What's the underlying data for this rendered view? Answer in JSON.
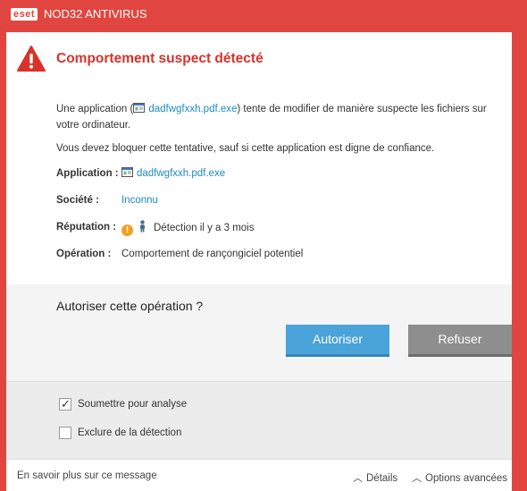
{
  "window": {
    "brand": "eset",
    "title": "NOD32 ANTIVIRUS",
    "accent": "#e0463f"
  },
  "alert": {
    "heading": "Comportement suspect détecté",
    "message_pre": "Une application (",
    "app_name": "dadfwgfxxh.pdf.exe",
    "message_post": ") tente de modifier de manière suspecte les fichiers sur votre ordinateur.",
    "advice": "Vous devez bloquer cette tentative, sauf si cette application est digne de confiance."
  },
  "details": {
    "application_label": "Application :",
    "application_value": "dadfwgfxxh.pdf.exe",
    "company_label": "Société :",
    "company_value": "Inconnu",
    "reputation_label": "Réputation :",
    "reputation_value": "Détection il y a 3 mois",
    "operation_label": "Opération :",
    "operation_value": "Comportement de rançongiciel potentiel"
  },
  "prompt": {
    "question": "Autoriser cette opération ?",
    "allow_label": "Autoriser",
    "deny_label": "Refuser"
  },
  "options": {
    "submit_label": "Soumettre pour analyse",
    "submit_checked": true,
    "exclude_label": "Exclure de la détection",
    "exclude_checked": false
  },
  "footer": {
    "learn_more": "En savoir plus sur ce message",
    "details": "Détails",
    "advanced": "Options avancées"
  }
}
